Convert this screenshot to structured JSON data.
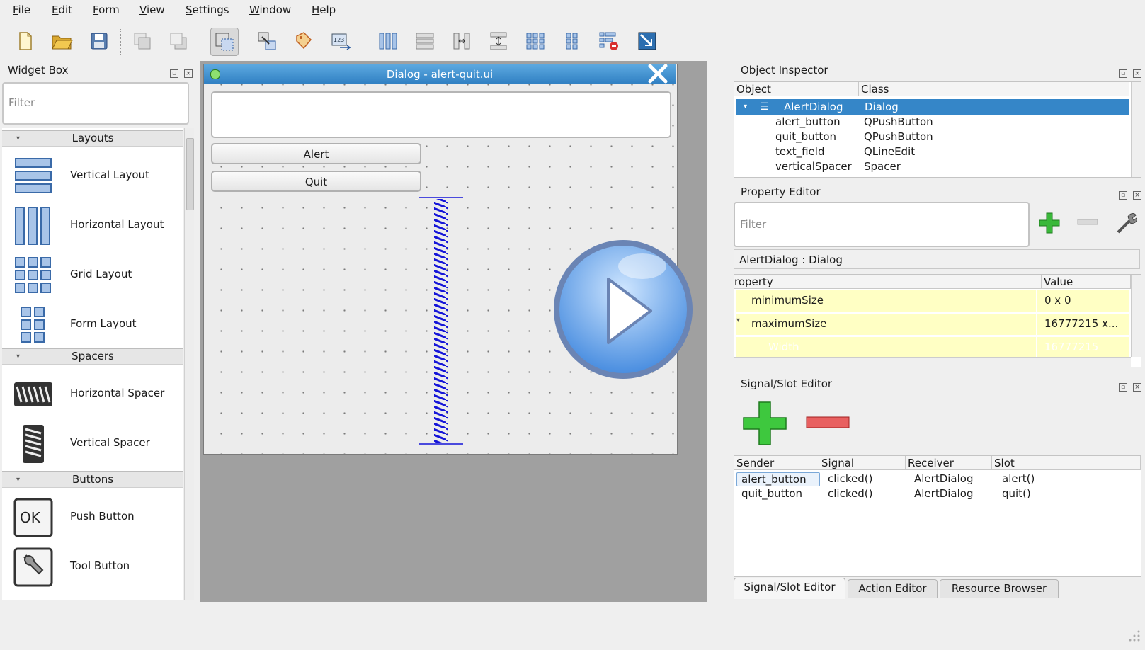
{
  "menu": [
    "File",
    "Edit",
    "Form",
    "View",
    "Settings",
    "Window",
    "Help"
  ],
  "toolbar": {
    "icons": [
      "new-form-icon",
      "open-form-icon",
      "save-form-icon",
      "send-to-back-icon",
      "bring-to-front-icon",
      "edit-widgets-icon",
      "edit-signals-slots-icon",
      "edit-buddies-icon",
      "edit-tab-order-icon",
      "lay-out-horizontally-icon",
      "lay-out-vertically-icon",
      "lay-out-horizontally-splitter-icon",
      "lay-out-vertically-splitter-icon",
      "lay-out-grid-icon",
      "lay-out-form-icon",
      "break-layout-icon",
      "adjust-size-icon"
    ]
  },
  "widget_box": {
    "title": "Widget Box",
    "filter_placeholder": "Filter",
    "categories": [
      {
        "name": "Layouts",
        "items": [
          "Vertical Layout",
          "Horizontal Layout",
          "Grid Layout",
          "Form Layout"
        ]
      },
      {
        "name": "Spacers",
        "items": [
          "Horizontal Spacer",
          "Vertical Spacer"
        ]
      },
      {
        "name": "Buttons",
        "items": [
          "Push Button",
          "Tool Button"
        ]
      }
    ]
  },
  "form": {
    "title": "Dialog - alert-quit.ui",
    "text_field_value": "",
    "alert_button": "Alert",
    "quit_button": "Quit"
  },
  "object_inspector": {
    "title": "Object Inspector",
    "headers": [
      "Object",
      "Class"
    ],
    "rows": [
      {
        "object": "AlertDialog",
        "class": "Dialog"
      },
      {
        "object": "alert_button",
        "class": "QPushButton"
      },
      {
        "object": "quit_button",
        "class": "QPushButton"
      },
      {
        "object": "text_field",
        "class": "QLineEdit"
      },
      {
        "object": "verticalSpacer",
        "class": "Spacer"
      }
    ]
  },
  "property_editor": {
    "title": "Property Editor",
    "filter_placeholder": "Filter",
    "context": "AlertDialog : Dialog",
    "headers": [
      "roperty",
      "Value"
    ],
    "rows": [
      {
        "name": "minimumSize",
        "value": "0 x 0"
      },
      {
        "name": "maximumSize",
        "value": "16777215 x..."
      },
      {
        "name": "Width",
        "value": "16777215"
      }
    ]
  },
  "signal_slot_editor": {
    "title": "Signal/Slot Editor",
    "headers": [
      "Sender",
      "Signal",
      "Receiver",
      "Slot"
    ],
    "rows": [
      {
        "sender": "alert_button",
        "signal": "clicked()",
        "receiver": "AlertDialog",
        "slot": "alert()"
      },
      {
        "sender": "quit_button",
        "signal": "clicked()",
        "receiver": "AlertDialog",
        "slot": "quit()"
      }
    ]
  },
  "bottom_tabs": [
    "Signal/Slot Editor",
    "Action Editor",
    "Resource Browser"
  ],
  "colors": {
    "selection": "#3586c8",
    "changed_property": "#ffffc4",
    "accent_green": "#2fa82f",
    "accent_red": "#e04848",
    "spacer_blue": "#1515d8"
  }
}
